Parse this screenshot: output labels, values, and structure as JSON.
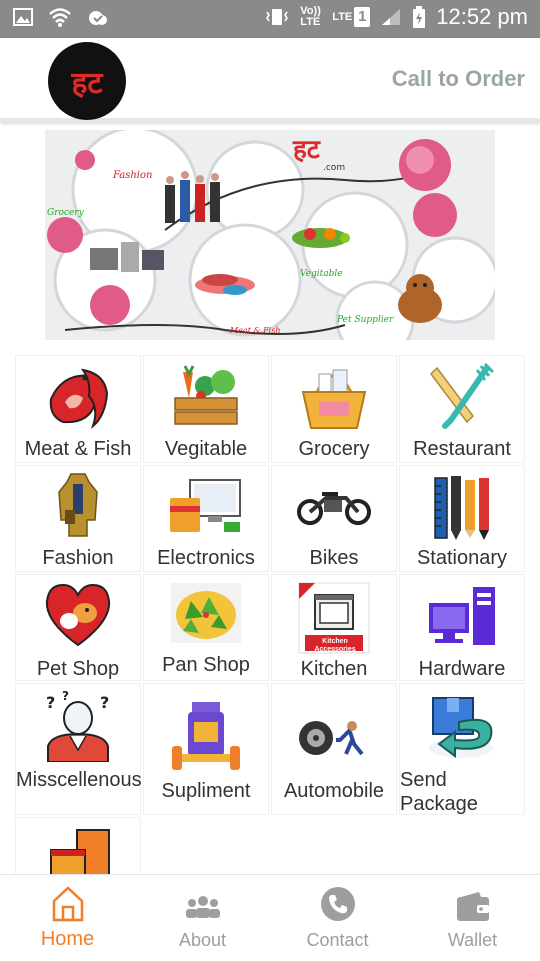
{
  "status_bar": {
    "time": "12:52 pm",
    "volte_label": "Vo)) LTE",
    "lte_label": "LTE",
    "sim_number": "1"
  },
  "header": {
    "logo_text": "हट",
    "call_to_order": "Call to Order"
  },
  "banner": {
    "logo_text": "हट",
    "logo_sub": ".com",
    "labels": [
      "Fashion",
      "Grocery",
      "Vegitable",
      "Pet Supplier",
      "Meat & Fish"
    ]
  },
  "categories": [
    {
      "label": "Meat & Fish",
      "icon": "meat-fish-icon"
    },
    {
      "label": "Vegitable",
      "icon": "vegetable-crate-icon"
    },
    {
      "label": "Grocery",
      "icon": "grocery-basket-icon"
    },
    {
      "label": "Restaurant",
      "icon": "fork-knife-icon"
    },
    {
      "label": "Fashion",
      "icon": "jacket-icon"
    },
    {
      "label": "Electronics",
      "icon": "electronics-icon"
    },
    {
      "label": "Bikes",
      "icon": "motorbike-icon"
    },
    {
      "label": "Stationary",
      "icon": "stationery-icon"
    },
    {
      "label": "Pet Shop",
      "icon": "pet-heart-icon"
    },
    {
      "label": "Pan Shop",
      "icon": "paan-icon"
    },
    {
      "label": "Kitchen",
      "icon": "kitchen-icon",
      "badge": "Kitchen Accessories"
    },
    {
      "label": "Hardware",
      "icon": "computer-hardware-icon"
    },
    {
      "label": "Misscellenous",
      "icon": "thinking-person-icon"
    },
    {
      "label": "Supliment",
      "icon": "dumbbell-supplement-icon"
    },
    {
      "label": "Automobile",
      "icon": "tyre-push-icon"
    },
    {
      "label": "Send Package",
      "icon": "send-package-icon"
    },
    {
      "label": "",
      "icon": "furniture-icon"
    }
  ],
  "bottom_nav": {
    "items": [
      {
        "label": "Home",
        "icon": "home-icon",
        "active": true
      },
      {
        "label": "About",
        "icon": "people-icon",
        "active": false
      },
      {
        "label": "Contact",
        "icon": "phone-icon",
        "active": false
      },
      {
        "label": "Wallet",
        "icon": "wallet-icon",
        "active": false
      }
    ]
  },
  "colors": {
    "status_bar": "#8a8a8a",
    "accent": "#f07f2a",
    "call_text": "#9aa5a5",
    "nav_inactive": "#9e9e9e"
  }
}
